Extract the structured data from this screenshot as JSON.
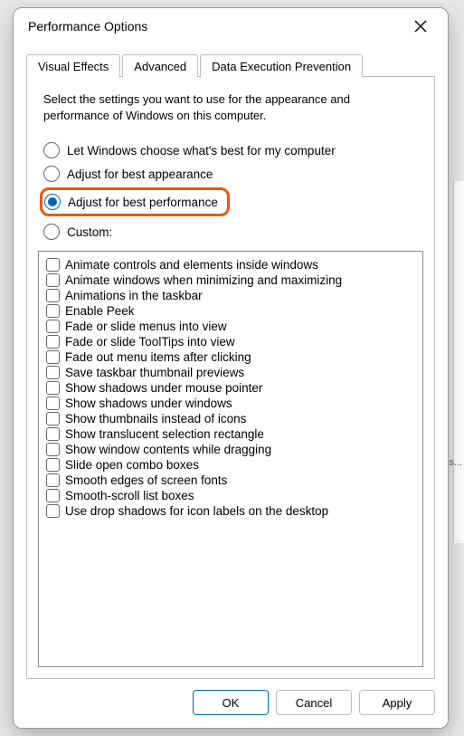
{
  "window": {
    "title": "Performance Options"
  },
  "tabs": [
    {
      "label": "Visual Effects",
      "active": true
    },
    {
      "label": "Advanced",
      "active": false
    },
    {
      "label": "Data Execution Prevention",
      "active": false
    }
  ],
  "intro": "Select the settings you want to use for the appearance and performance of Windows on this computer.",
  "radios": [
    {
      "id": "auto",
      "label": "Let Windows choose what's best for my computer",
      "checked": false
    },
    {
      "id": "bestapp",
      "label": "Adjust for best appearance",
      "checked": false
    },
    {
      "id": "bestperf",
      "label": "Adjust for best performance",
      "checked": true,
      "highlighted": true
    },
    {
      "id": "custom",
      "label": "Custom:",
      "checked": false
    }
  ],
  "checks": [
    {
      "label": "Animate controls and elements inside windows",
      "checked": false
    },
    {
      "label": "Animate windows when minimizing and maximizing",
      "checked": false
    },
    {
      "label": "Animations in the taskbar",
      "checked": false
    },
    {
      "label": "Enable Peek",
      "checked": false
    },
    {
      "label": "Fade or slide menus into view",
      "checked": false
    },
    {
      "label": "Fade or slide ToolTips into view",
      "checked": false
    },
    {
      "label": "Fade out menu items after clicking",
      "checked": false
    },
    {
      "label": "Save taskbar thumbnail previews",
      "checked": false
    },
    {
      "label": "Show shadows under mouse pointer",
      "checked": false
    },
    {
      "label": "Show shadows under windows",
      "checked": false
    },
    {
      "label": "Show thumbnails instead of icons",
      "checked": false
    },
    {
      "label": "Show translucent selection rectangle",
      "checked": false
    },
    {
      "label": "Show window contents while dragging",
      "checked": false
    },
    {
      "label": "Slide open combo boxes",
      "checked": false
    },
    {
      "label": "Smooth edges of screen fonts",
      "checked": false
    },
    {
      "label": "Smooth-scroll list boxes",
      "checked": false
    },
    {
      "label": "Use drop shadows for icon labels on the desktop",
      "checked": false
    }
  ],
  "buttons": {
    "ok": "OK",
    "cancel": "Cancel",
    "apply": "Apply"
  },
  "bg_hint_text": "es..."
}
